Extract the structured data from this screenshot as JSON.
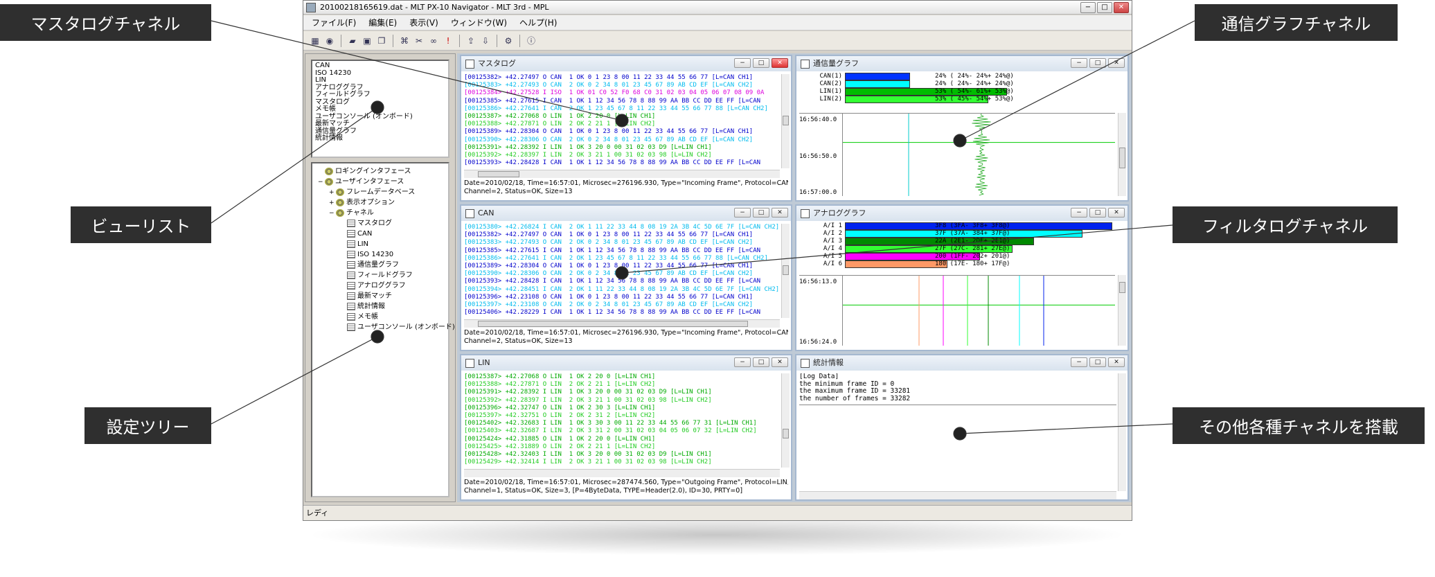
{
  "window": {
    "title": "20100218165619.dat - MLT PX-10 Navigator - MLT 3rd - MPL"
  },
  "menu": [
    "ファイル(F)",
    "編集(E)",
    "表示(V)",
    "ウィンドウ(W)",
    "ヘルプ(H)"
  ],
  "toolbar": {
    "icons": [
      "config-icon",
      "stop-icon",
      "open-folder-icon",
      "save-icon",
      "copy-icon",
      "filter-icon",
      "cut-icon",
      "binoculars-icon",
      "alert-icon",
      "export-icon",
      "import-icon",
      "settings-icon",
      "info-icon"
    ]
  },
  "viewlist": [
    "CAN",
    "ISO 14230",
    "LIN",
    "アナロググラフ",
    "フィールドグラフ",
    "マスタログ",
    "メモ帳",
    "ユーザコンソール (オンボード)",
    "最新マッチ",
    "通信量グラフ",
    "統計情報"
  ],
  "tree": [
    {
      "label": "ロギングインタフェース",
      "level": 0,
      "icon": "gear",
      "toggle": ""
    },
    {
      "label": "ユーザインタフェース",
      "level": 0,
      "icon": "gear",
      "toggle": "−"
    },
    {
      "label": "フレームデータベース",
      "level": 1,
      "icon": "gear",
      "toggle": "+"
    },
    {
      "label": "表示オプション",
      "level": 1,
      "icon": "gear",
      "toggle": "+"
    },
    {
      "label": "チャネル",
      "level": 1,
      "icon": "gear",
      "toggle": "−"
    },
    {
      "label": "マスタログ",
      "level": 2,
      "icon": "doc",
      "toggle": ""
    },
    {
      "label": "CAN",
      "level": 2,
      "icon": "doc",
      "toggle": ""
    },
    {
      "label": "LIN",
      "level": 2,
      "icon": "doc",
      "toggle": ""
    },
    {
      "label": "ISO 14230",
      "level": 2,
      "icon": "doc",
      "toggle": ""
    },
    {
      "label": "通信量グラフ",
      "level": 2,
      "icon": "doc",
      "toggle": ""
    },
    {
      "label": "フィールドグラフ",
      "level": 2,
      "icon": "doc",
      "toggle": ""
    },
    {
      "label": "アナロググラフ",
      "level": 2,
      "icon": "doc",
      "toggle": ""
    },
    {
      "label": "最新マッチ",
      "level": 2,
      "icon": "doc",
      "toggle": ""
    },
    {
      "label": "統計情報",
      "level": 2,
      "icon": "doc",
      "toggle": ""
    },
    {
      "label": "メモ帳",
      "level": 2,
      "icon": "doc",
      "toggle": ""
    },
    {
      "label": "ユーザコンソール (オンボード)",
      "level": 2,
      "icon": "doc",
      "toggle": ""
    }
  ],
  "master_log": {
    "title": "マスタログ",
    "lines": [
      {
        "t": "[00125382> +42.27497 O CAN  1 OK 0 1 23 8 00 11 22 33 44 55 66 77 [L=CAN CH1]",
        "c": "#0000cc"
      },
      {
        "t": "[00125383> +42.27493 O CAN  2 OK 0 2 34 8 01 23 45 67 89 AB CD EF [L=CAN CH2]",
        "c": "#00bbee"
      },
      {
        "t": "[00125384> +42.27528 I ISO  1 OK 01 C0 52 F0 68 C0 31 02 03 04 05 06 07 08 09 0A",
        "c": "#dd00dd"
      },
      {
        "t": "[00125385> +42.27615 I CAN  1 OK 1 12 34 56 78 8 88 99 AA BB CC DD EE FF [L=CAN",
        "c": "#0000cc"
      },
      {
        "t": "[00125386> +42.27641 I CAN  2 OK 1 23 45 67 8 11 22 33 44 55 66 77 88 [L=CAN CH2]",
        "c": "#00bbee"
      },
      {
        "t": "[00125387> +42.27068 O LIN  1 OK 2 20 0 [L=LIN CH1]",
        "c": "#00aa00"
      },
      {
        "t": "[00125388> +42.27871 O LIN  2 OK 2 21 1 [L=LIN CH2]",
        "c": "#22cc22"
      },
      {
        "t": "[00125389> +42.28304 O CAN  1 OK 0 1 23 8 00 11 22 33 44 55 66 77 [L=CAN CH1]",
        "c": "#0000cc"
      },
      {
        "t": "[00125390> +42.28306 O CAN  2 OK 0 2 34 8 01 23 45 67 89 AB CD EF [L=CAN CH2]",
        "c": "#00bbee"
      },
      {
        "t": "[00125391> +42.28392 I LIN  1 OK 3 20 0 00 31 02 03 D9 [L=LIN CH1]",
        "c": "#00aa00"
      },
      {
        "t": "[00125392> +42.28397 I LIN  2 OK 3 21 1 00 31 02 03 98 [L=LIN CH2]",
        "c": "#22cc22"
      },
      {
        "t": "[00125393> +42.28428 I CAN  1 OK 1 12 34 56 78 8 88 99 AA BB CC DD EE FF [L=CAN",
        "c": "#0000cc"
      }
    ],
    "status": "Date=2010/02/18, Time=16:57:01, Microsec=276196.930, Type=\"Incoming Frame\", Protocol=CAN,\nChannel=2, Status=OK, Size=13"
  },
  "can": {
    "title": "CAN",
    "lines": [
      {
        "t": "[00125380> +42.26824 I CAN  2 OK 1 11 22 33 44 8 08 19 2A 3B 4C 5D 6E 7F [L=CAN CH2]",
        "c": "#00bbee"
      },
      {
        "t": "[00125382> +42.27497 O CAN  1 OK 0 1 23 8 00 11 22 33 44 55 66 77 [L=CAN CH1]",
        "c": "#0000cc"
      },
      {
        "t": "[00125383> +42.27493 O CAN  2 OK 0 2 34 8 01 23 45 67 89 AB CD EF [L=CAN CH2]",
        "c": "#00bbee"
      },
      {
        "t": "[00125385> +42.27615 I CAN  1 OK 1 12 34 56 78 8 88 99 AA BB CC DD EE FF [L=CAN",
        "c": "#0000cc"
      },
      {
        "t": "[00125386> +42.27641 I CAN  2 OK 1 23 45 67 8 11 22 33 44 55 66 77 88 [L=CAN CH2]",
        "c": "#00bbee"
      },
      {
        "t": "[00125389> +42.28304 O CAN  1 OK 0 1 23 8 00 11 22 33 44 55 66 77 [L=CAN CH1]",
        "c": "#0000cc"
      },
      {
        "t": "[00125390> +42.28306 O CAN  2 OK 0 2 34 8 01 23 45 67 89 AB CD EF [L=CAN CH2]",
        "c": "#00bbee"
      },
      {
        "t": "[00125393> +42.28428 I CAN  1 OK 1 12 34 56 78 8 88 99 AA BB CC DD EE FF [L=CAN",
        "c": "#0000cc"
      },
      {
        "t": "[00125394> +42.28451 I CAN  2 OK 1 11 22 33 44 8 08 19 2A 3B 4C 5D 6E 7F [L=CAN CH2]",
        "c": "#00bbee"
      },
      {
        "t": "[00125396> +42.23108 O CAN  1 OK 0 1 23 8 00 11 22 33 44 55 66 77 [L=CAN CH1]",
        "c": "#0000cc"
      },
      {
        "t": "[00125397> +42.23108 O CAN  2 OK 0 2 34 8 01 23 45 67 89 AB CD EF [L=CAN CH2]",
        "c": "#00bbee"
      },
      {
        "t": "[00125406> +42.28229 I CAN  1 OK 1 12 34 56 78 8 88 99 AA BB CC DD EE FF [L=CAN",
        "c": "#0000cc"
      }
    ],
    "status": "Date=2010/02/18, Time=16:57:01, Microsec=276196.930, Type=\"Incoming Frame\", Protocol=CAN,\nChannel=2, Status=OK, Size=13"
  },
  "lin": {
    "title": "LIN",
    "lines": [
      {
        "t": "[00125387> +42.27068 O LIN  1 OK 2 20 0 [L=LIN CH1]",
        "c": "#00aa00"
      },
      {
        "t": "[00125388> +42.27871 O LIN  2 OK 2 21 1 [L=LIN CH2]",
        "c": "#22cc22"
      },
      {
        "t": "[00125391> +42.28392 I LIN  1 OK 3 20 0 00 31 02 03 D9 [L=LIN CH1]",
        "c": "#00aa00"
      },
      {
        "t": "[00125392> +42.28397 I LIN  2 OK 3 21 1 00 31 02 03 98 [L=LIN CH2]",
        "c": "#22cc22"
      },
      {
        "t": "[00125396> +42.32747 O LIN  1 OK 2 30 3 [L=LIN CH1]",
        "c": "#00aa00"
      },
      {
        "t": "[00125397> +42.32751 O LIN  2 OK 2 31 2 [L=LIN CH2]",
        "c": "#22cc22"
      },
      {
        "t": "[00125402> +42.32683 I LIN  1 OK 3 30 3 00 11 22 33 44 55 66 77 31 [L=LIN CH1]",
        "c": "#00aa00"
      },
      {
        "t": "[00125403> +42.32687 I LIN  2 OK 3 31 2 00 31 02 03 04 05 06 07 32 [L=LIN CH2]",
        "c": "#22cc22"
      },
      {
        "t": "[00125424> +42.31885 O LIN  1 OK 2 20 0 [L=LIN CH1]",
        "c": "#00aa00"
      },
      {
        "t": "[00125425> +42.31889 O LIN  2 OK 2 21 1 [L=LIN CH2]",
        "c": "#22cc22"
      },
      {
        "t": "[00125428> +42.32403 I LIN  1 OK 3 20 0 00 31 02 03 D9 [L=LIN CH1]",
        "c": "#00aa00"
      },
      {
        "t": "[00125429> +42.32414 I LIN  2 OK 3 21 1 00 31 02 03 98 [L=LIN CH2]",
        "c": "#22cc22"
      }
    ],
    "status": "Date=2010/02/18, Time=16:57:01, Microsec=287474.560, Type=\"Outgoing Frame\", Protocol=LIN,\nChannel=1, Status=OK, Size=3, [P=4ByteData, TYPE=Header(2.0), ID=30, PRTY=0]"
  },
  "traffic_graph": {
    "title": "通信量グラフ",
    "rows": [
      {
        "label": "CAN(1)",
        "text": "24% ( 24%- 24%+ 24%@)",
        "pct": 24,
        "color": "#0033ff"
      },
      {
        "label": "CAN(2)",
        "text": "24% ( 24%- 24%+ 24%@)",
        "pct": 24,
        "color": "#00ffff"
      },
      {
        "label": "LIN(1)",
        "text": "53% ( 54%- 61%+ 53%@)",
        "pct": 60,
        "color": "#00bb00"
      },
      {
        "label": "LIN(2)",
        "text": "53% ( 45%- 54%+ 53%@)",
        "pct": 53,
        "color": "#33ff33"
      }
    ],
    "times": [
      "16:56:40.0",
      "16:56:50.0",
      "16:57:00.0"
    ]
  },
  "analog_graph": {
    "title": "アナロググラフ",
    "rows": [
      {
        "label": "A/I 1",
        "text": "3F8 (3FA- 3F8+ 3F8@)",
        "pct": 99,
        "color": "#0022ee"
      },
      {
        "label": "A/I 2",
        "text": "37F (37A- 384+ 37F@)",
        "pct": 88,
        "color": "#00ffff"
      },
      {
        "label": "A/I 3",
        "text": "22A (2E1- 2DF+ 2E1@)",
        "pct": 70,
        "color": "#008800"
      },
      {
        "label": "A/I 4",
        "text": "27F (27C- 281+ 27E@)",
        "pct": 62,
        "color": "#33ff33"
      },
      {
        "label": "A/I 5",
        "text": "200 (1FF- 202+ 201@)",
        "pct": 50,
        "color": "#ff00ff"
      },
      {
        "label": "A/I 6",
        "text": "180 (17E- 180+ 17F@)",
        "pct": 38,
        "color": "#ff9966"
      }
    ],
    "times": [
      "16:56:13.0",
      "16:56:24.0"
    ]
  },
  "stats": {
    "title": "統計情報",
    "lines": [
      "[Log Data]",
      "the minimum frame ID = 0",
      "the maximum frame ID = 33281",
      "the number of frames = 33282"
    ]
  },
  "statusbar": {
    "text": "レディ"
  },
  "callouts": {
    "master_log": "マスタログチャネル",
    "view_list": "ビューリスト",
    "settings_tree": "設定ツリー",
    "traffic_graph": "通信グラフチャネル",
    "filter_log": "フィルタログチャネル",
    "others": "その他各種チャネルを搭載"
  },
  "colors": {
    "callout_bg": "#2f2f2f",
    "mdi_bg": "#bfcad6",
    "frame_border": "#a5b8d0"
  }
}
